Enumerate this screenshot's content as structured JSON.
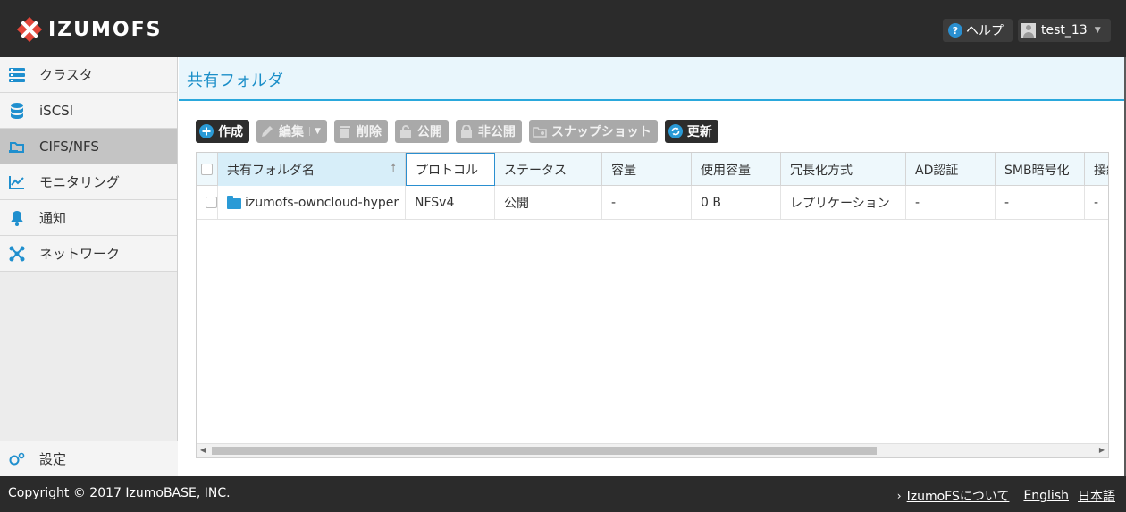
{
  "header": {
    "logo_text": "IZUMOFS",
    "help_label": "ヘルプ",
    "user_name": "test_13"
  },
  "sidebar": {
    "items": [
      {
        "label": "クラスタ",
        "icon": "server-stack-icon"
      },
      {
        "label": "iSCSI",
        "icon": "database-icon"
      },
      {
        "label": "CIFS/NFS",
        "icon": "shared-folder-icon",
        "active": true
      },
      {
        "label": "モニタリング",
        "icon": "chart-line-icon"
      },
      {
        "label": "通知",
        "icon": "bell-icon"
      },
      {
        "label": "ネットワーク",
        "icon": "network-icon"
      }
    ],
    "settings_label": "設定"
  },
  "main": {
    "page_title": "共有フォルダ",
    "toolbar": {
      "create": "作成",
      "edit": "編集",
      "delete": "削除",
      "publish": "公開",
      "unpublish": "非公開",
      "snapshot": "スナップショット",
      "refresh": "更新"
    },
    "grid": {
      "columns": [
        "共有フォルダ名",
        "プロトコル",
        "ステータス",
        "容量",
        "使用容量",
        "冗長化方式",
        "AD認証",
        "SMB暗号化",
        "接続"
      ],
      "rows": [
        [
          "izumofs-owncloud-hyper",
          "NFSv4",
          "公開",
          "-",
          "0 B",
          "レプリケーション",
          "-",
          "-",
          "-"
        ]
      ]
    }
  },
  "footer": {
    "copyright": "Copyright © 2017 IzumoBASE, INC.",
    "about": "IzumoFSについて",
    "english": "English",
    "japanese": "日本語"
  },
  "colors": {
    "accent": "#2aa8dc",
    "header_bg": "#2b2b2b",
    "title_text": "#1a8ec8"
  }
}
